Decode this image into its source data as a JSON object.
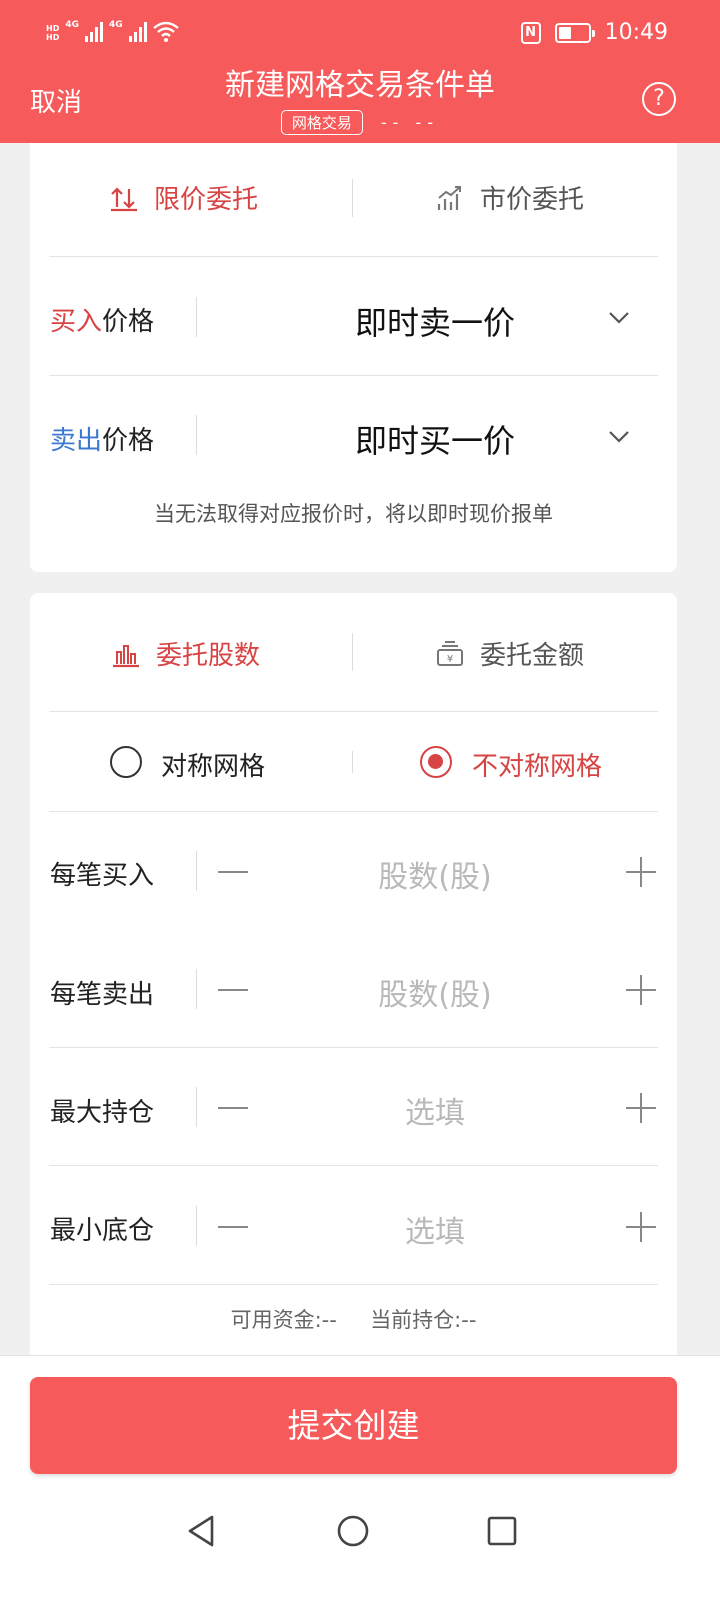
{
  "status_bar": {
    "hd": "HD",
    "network1": "4G",
    "network2": "4G",
    "nfc": "N",
    "time": "10:49"
  },
  "header": {
    "cancel": "取消",
    "title": "新建网格交易条件单",
    "badge": "网格交易",
    "stock_code": "-- --",
    "help": "?"
  },
  "order_type": {
    "limit": "限价委托",
    "market": "市价委托"
  },
  "price": {
    "buy_label_colored": "买入",
    "buy_label_rest": "价格",
    "buy_value": "即时卖一价",
    "sell_label_colored": "卖出",
    "sell_label_rest": "价格",
    "sell_value": "即时买一价",
    "hint": "当无法取得对应报价时，将以即时现价报单"
  },
  "entrust_mode": {
    "shares": "委托股数",
    "amount": "委托金额"
  },
  "grid_type": {
    "symmetric": "对称网格",
    "asymmetric": "不对称网格"
  },
  "fields": {
    "buy_each": {
      "label": "每笔买入",
      "placeholder": "股数(股)"
    },
    "sell_each": {
      "label": "每笔卖出",
      "placeholder": "股数(股)"
    },
    "max_position": {
      "label": "最大持仓",
      "placeholder": "选填"
    },
    "min_position": {
      "label": "最小底仓",
      "placeholder": "选填"
    }
  },
  "info": {
    "available_funds": "可用资金:--",
    "current_position": "当前持仓:--"
  },
  "submit": "提交创建",
  "colors": {
    "brand_red": "#f65a5a",
    "accent_red": "#d84343",
    "accent_blue": "#3b78d1"
  }
}
